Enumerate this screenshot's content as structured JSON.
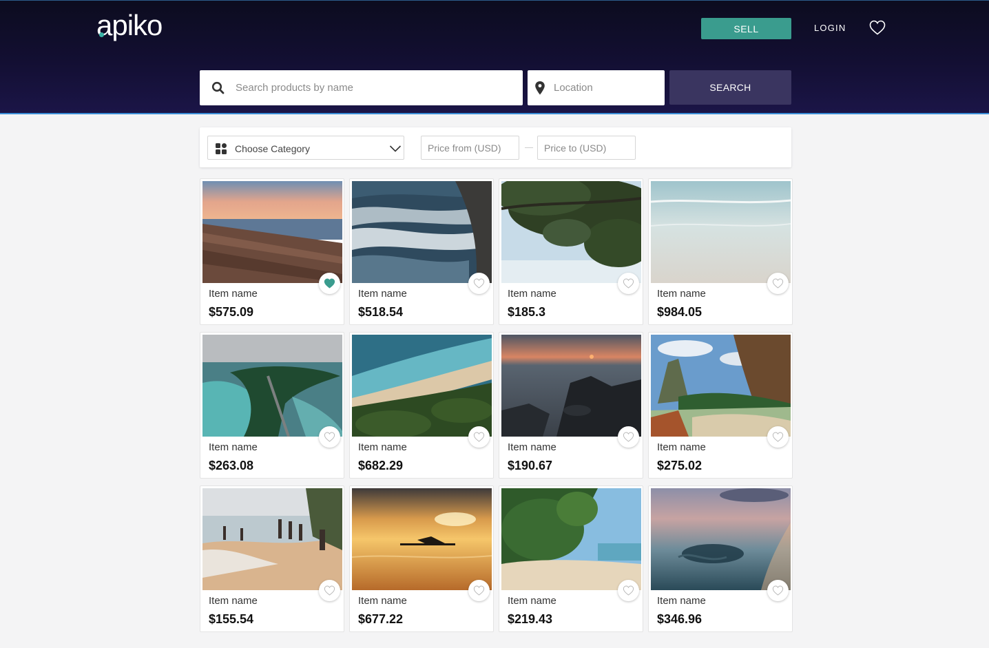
{
  "header": {
    "logo": "apiko",
    "sell_label": "SELL",
    "login_label": "LOGIN",
    "accent_color": "#3a9c8e",
    "search_button_color": "#3a3560"
  },
  "search": {
    "placeholder": "Search products by name",
    "location_placeholder": "Location",
    "button_label": "SEARCH"
  },
  "filters": {
    "category_label": "Choose Category",
    "price_from_placeholder": "Price from (USD)",
    "price_to_placeholder": "Price to (USD)"
  },
  "products": [
    {
      "name": "Item name",
      "price": "$575.09",
      "favorited": true,
      "image": "sunset-beach"
    },
    {
      "name": "Item name",
      "price": "$518.54",
      "favorited": false,
      "image": "ocean-waves"
    },
    {
      "name": "Item name",
      "price": "$185.3",
      "favorited": false,
      "image": "tree-canopy"
    },
    {
      "name": "Item name",
      "price": "$984.05",
      "favorited": false,
      "image": "calm-shore"
    },
    {
      "name": "Item name",
      "price": "$263.08",
      "favorited": false,
      "image": "aerial-island-road"
    },
    {
      "name": "Item name",
      "price": "$682.29",
      "favorited": false,
      "image": "aerial-beach-jungle"
    },
    {
      "name": "Item name",
      "price": "$190.67",
      "favorited": false,
      "image": "rocky-sunset"
    },
    {
      "name": "Item name",
      "price": "$275.02",
      "favorited": false,
      "image": "tropical-cliffs"
    },
    {
      "name": "Item name",
      "price": "$155.54",
      "favorited": false,
      "image": "fishermen-beach"
    },
    {
      "name": "Item name",
      "price": "$677.22",
      "favorited": false,
      "image": "golden-surfer"
    },
    {
      "name": "Item name",
      "price": "$219.43",
      "favorited": false,
      "image": "palm-beach"
    },
    {
      "name": "Item name",
      "price": "$346.96",
      "favorited": false,
      "image": "aerial-reef-dusk"
    }
  ]
}
